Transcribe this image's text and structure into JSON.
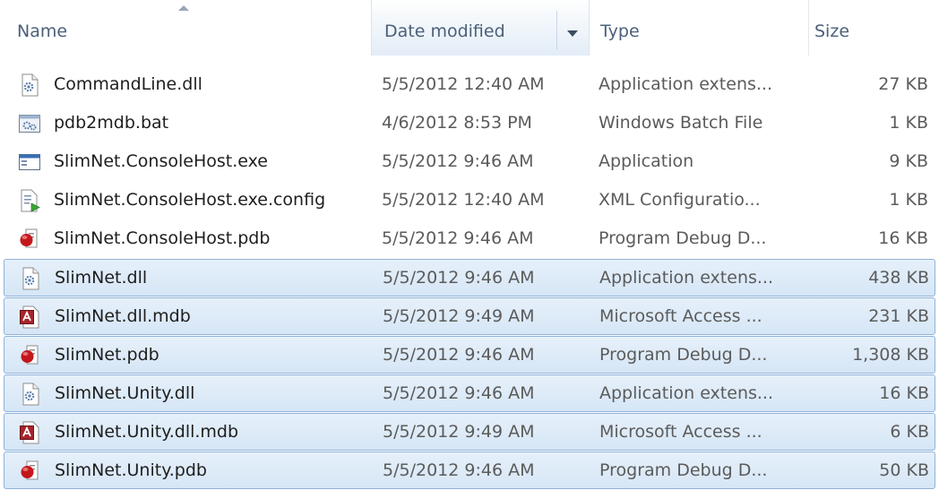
{
  "columns": {
    "name": "Name",
    "date": "Date modified",
    "type": "Type",
    "size": "Size"
  },
  "files": [
    {
      "name": "CommandLine.dll",
      "date": "5/5/2012 12:40 AM",
      "type": "Application extens...",
      "size": "27 KB",
      "icon": "dll-gear-icon",
      "selected": false
    },
    {
      "name": "pdb2mdb.bat",
      "date": "4/6/2012 8:53 PM",
      "type": "Windows Batch File",
      "size": "1 KB",
      "icon": "batch-file-icon",
      "selected": false
    },
    {
      "name": "SlimNet.ConsoleHost.exe",
      "date": "5/5/2012 9:46 AM",
      "type": "Application",
      "size": "9 KB",
      "icon": "application-window-icon",
      "selected": false
    },
    {
      "name": "SlimNet.ConsoleHost.exe.config",
      "date": "5/5/2012 12:40 AM",
      "type": "XML Configuratio...",
      "size": "1 KB",
      "icon": "config-file-icon",
      "selected": false
    },
    {
      "name": "SlimNet.ConsoleHost.pdb",
      "date": "5/5/2012 9:46 AM",
      "type": "Program Debug D...",
      "size": "16 KB",
      "icon": "pdb-red-ball-icon",
      "selected": false
    },
    {
      "name": "SlimNet.dll",
      "date": "5/5/2012 9:46 AM",
      "type": "Application extens...",
      "size": "438 KB",
      "icon": "dll-gear-icon",
      "selected": true
    },
    {
      "name": "SlimNet.dll.mdb",
      "date": "5/5/2012 9:49 AM",
      "type": "Microsoft Access ...",
      "size": "231 KB",
      "icon": "access-mdb-icon",
      "selected": true
    },
    {
      "name": "SlimNet.pdb",
      "date": "5/5/2012 9:46 AM",
      "type": "Program Debug D...",
      "size": "1,308 KB",
      "icon": "pdb-red-ball-icon",
      "selected": true
    },
    {
      "name": "SlimNet.Unity.dll",
      "date": "5/5/2012 9:46 AM",
      "type": "Application extens...",
      "size": "16 KB",
      "icon": "dll-gear-icon",
      "selected": true
    },
    {
      "name": "SlimNet.Unity.dll.mdb",
      "date": "5/5/2012 9:49 AM",
      "type": "Microsoft Access ...",
      "size": "6 KB",
      "icon": "access-mdb-icon",
      "selected": true
    },
    {
      "name": "SlimNet.Unity.pdb",
      "date": "5/5/2012 9:46 AM",
      "type": "Program Debug D...",
      "size": "50 KB",
      "icon": "pdb-red-ball-icon",
      "selected": true
    }
  ],
  "colors": {
    "header_text": "#4c607a",
    "selection_fill": "#dbe8f6",
    "selection_border": "#8fb2da",
    "secondary_text": "#5b5b5b"
  }
}
